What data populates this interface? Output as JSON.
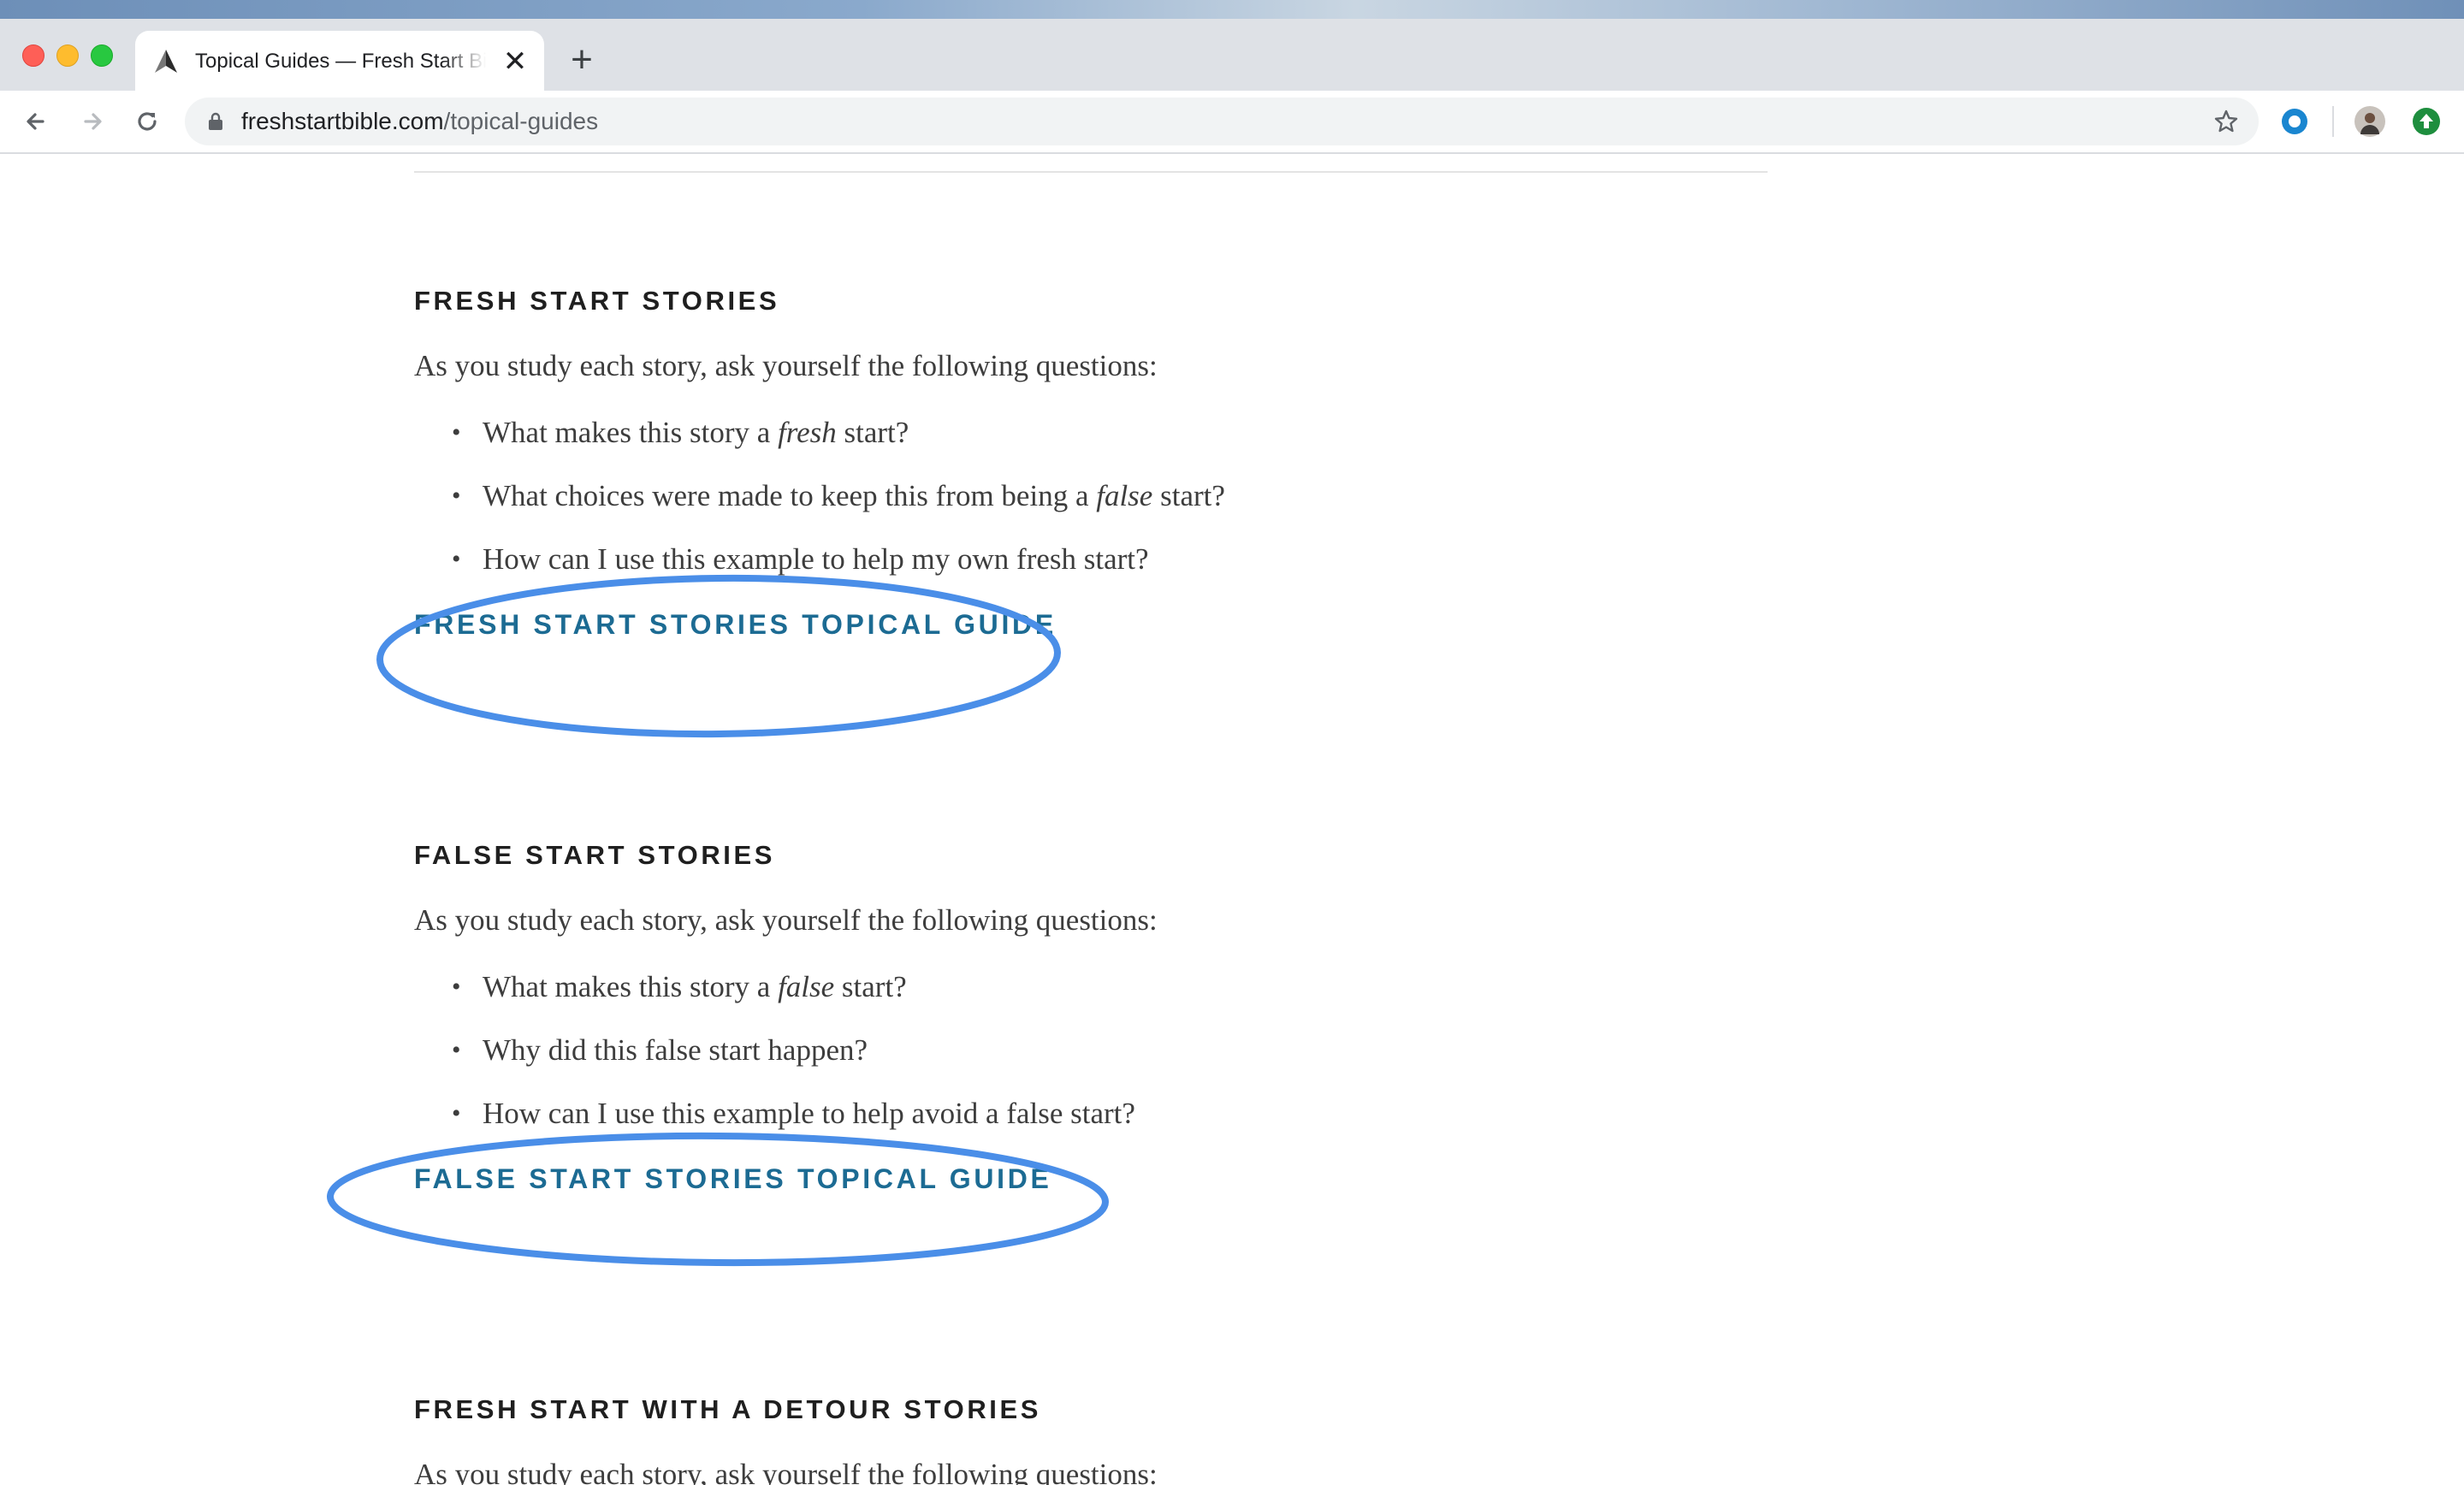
{
  "browser": {
    "tab": {
      "title": "Topical Guides — Fresh Start Bible",
      "close_label": "✕"
    },
    "new_tab_label": "+",
    "url": {
      "host": "freshstartbible.com",
      "path": "/topical-guides"
    }
  },
  "sections": [
    {
      "heading": "FRESH START STORIES",
      "intro": "As you study each story, ask yourself the following questions:",
      "questions": [
        {
          "before": "What makes this story a ",
          "emphasis": "fresh",
          "after": " start?"
        },
        {
          "before": "What choices were made to keep this from being a ",
          "emphasis": "false",
          "after": " start?"
        },
        {
          "before": "How can I use this example to help my own fresh start?",
          "emphasis": "",
          "after": ""
        }
      ],
      "link": "FRESH START STORIES TOPICAL GUIDE"
    },
    {
      "heading": "FALSE START STORIES",
      "intro": "As you study each story, ask yourself the following questions:",
      "questions": [
        {
          "before": "What makes this story a ",
          "emphasis": "false",
          "after": " start?"
        },
        {
          "before": "Why did this false start happen?",
          "emphasis": "",
          "after": ""
        },
        {
          "before": "How can I use this example to help avoid a false start?",
          "emphasis": "",
          "after": ""
        }
      ],
      "link": "FALSE START STORIES TOPICAL GUIDE"
    },
    {
      "heading": "FRESH START WITH A DETOUR STORIES",
      "intro": "As you study each story, ask yourself the following questions:"
    }
  ],
  "bullet_glyph": "•",
  "colors": {
    "link": "#1c6b93",
    "annotation": "#4a8ee8",
    "heading": "#1f1f1f",
    "body_text": "#3d3d3d"
  },
  "icons": [
    "back-arrow-icon",
    "forward-arrow-icon",
    "reload-icon",
    "lock-icon",
    "star-icon",
    "circle-extension-icon",
    "avatar-icon",
    "update-arrow-icon"
  ]
}
